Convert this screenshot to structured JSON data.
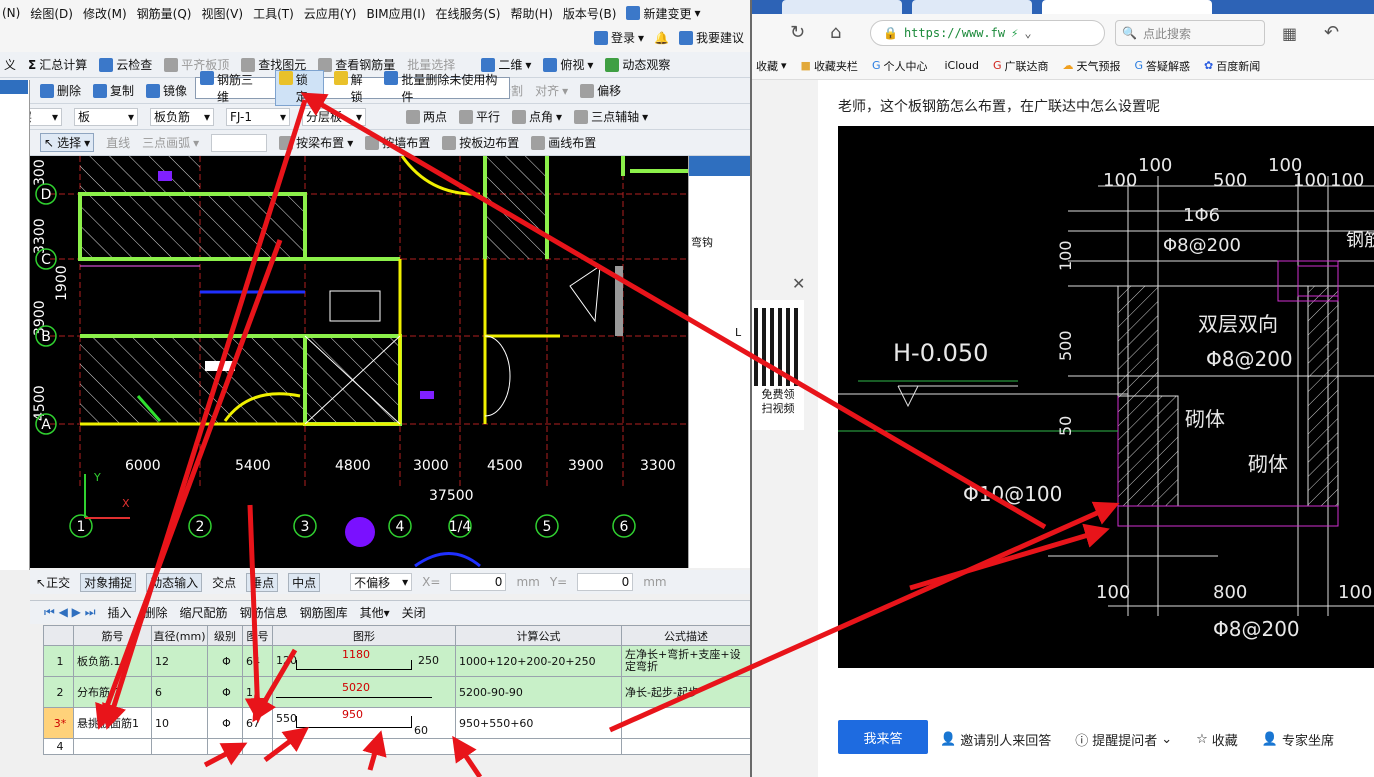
{
  "app": {
    "menus": [
      "(N)",
      "绘图(D)",
      "修改(M)",
      "钢筋量(Q)",
      "视图(V)",
      "工具(T)",
      "云应用(Y)",
      "BIM应用(I)",
      "在线服务(S)",
      "帮助(H)",
      "版本号(B)"
    ],
    "new_change": "新建变更",
    "login": "登录",
    "suggest": "我要建议",
    "toolbar1": [
      "义",
      "汇总计算",
      "云检查",
      "平齐板顶",
      "查找图元",
      "查看钢筋量",
      "批量选择",
      "二维",
      "俯视",
      "动态观察"
    ],
    "popup": {
      "steel3d": "钢筋三维",
      "lock": "锁定",
      "unlock": "解锁",
      "batch_delete": "批量删除未使用构件"
    },
    "toolbar2": {
      "delete": "删除",
      "copy": "复制",
      "mirror": "镜像",
      "split": "分割",
      "align": "对齐",
      "offset": "偏移"
    },
    "toolbar3": {
      "floor": "首层",
      "type": "板",
      "sub": "板负筋",
      "code": "FJ-1",
      "layer": "分层板",
      "two_point": "两点",
      "parallel": "平行",
      "point_angle": "点角",
      "three_point_axis": "三点辅轴"
    },
    "toolbar4": {
      "select": "选择",
      "line": "直线",
      "arc": "三点画弧",
      "by_beam": "按梁布置",
      "by_wall": "按墙布置",
      "by_edge": "按板边布置",
      "draw_line": "画线布置"
    },
    "cad": {
      "x_dims": [
        "6000",
        "5400",
        "4800",
        "3000",
        "4500",
        "3900",
        "3300"
      ],
      "total": "37500",
      "axes_x": [
        "1",
        "2",
        "3",
        "4",
        "1/4",
        "5",
        "6"
      ],
      "axes_y": [
        "D",
        "C",
        "B",
        "A"
      ],
      "y_dims": [
        "300",
        "3300",
        "1900",
        "3900",
        "4500"
      ],
      "axis_y_label": "Y",
      "axis_x_label": "X"
    },
    "right_panel": {
      "hook": "弯钩",
      "mark": "L"
    },
    "snapbar": {
      "ortho": "正交",
      "snap": "对象捕捉",
      "dynamic": "动态输入",
      "intersect": "交点",
      "perp": "垂点",
      "mid": "中点",
      "no_offset": "不偏移",
      "x_label": "X=",
      "x_val": "0",
      "mm1": "mm",
      "y_label": "Y=",
      "y_val": "0",
      "mm2": "mm"
    },
    "navbar": {
      "insert": "插入",
      "delete": "删除",
      "scale": "缩尺配筋",
      "info": "钢筋信息",
      "lib": "钢筋图库",
      "other": "其他",
      "close": "关闭"
    },
    "table": {
      "headers": [
        "",
        "筋号",
        "直径(mm)",
        "级别",
        "图号",
        "图形",
        "计算公式",
        "公式描述"
      ],
      "rows": [
        {
          "idx": "1",
          "name": "板负筋.1",
          "dia": "12",
          "grade": "Φ",
          "fig": "64",
          "l": "120",
          "m": "1180",
          "r": "250",
          "formula": "1000+120+200-20+250",
          "desc": "左净长+弯折+支座+设定弯折"
        },
        {
          "idx": "2",
          "name": "分布筋.1",
          "dia": "6",
          "grade": "Φ",
          "fig": "1",
          "l": "",
          "m": "5020",
          "r": "",
          "formula": "5200-90-90",
          "desc": "净长-起步-起步"
        },
        {
          "idx": "3*",
          "name": "悬挑板面筋1",
          "dia": "10",
          "grade": "Φ",
          "fig": "67",
          "l": "550",
          "m": "950",
          "r": "60",
          "formula": "950+550+60",
          "desc": ""
        },
        {
          "idx": "4",
          "name": "",
          "dia": "",
          "grade": "",
          "fig": "",
          "l": "",
          "m": "",
          "r": "",
          "formula": "",
          "desc": ""
        }
      ]
    }
  },
  "browser": {
    "url": "https://www.fw",
    "search_placeholder": "点此搜索",
    "bookmarks": [
      "收藏",
      "收藏夹栏",
      "个人中心",
      "iCloud",
      "广联达商",
      "天气预报",
      "答疑解惑",
      "百度新闻"
    ],
    "question": "老师，这个板钢筋怎么布置，在广联达中怎么设置呢",
    "qr_text1": "免费领",
    "qr_text2": "扫视频",
    "answer_btn": "我来答",
    "actions": [
      "邀请别人来回答",
      "提醒提问者",
      "收藏",
      "专家坐席"
    ],
    "dwg": {
      "top_dims": [
        "100",
        "100",
        "500",
        "100",
        "100",
        "100"
      ],
      "bar1": "1Φ6",
      "bar2": "Φ8@200",
      "steel": "钢筋",
      "level": "H-0.050",
      "left_dims": [
        "100",
        "500",
        "50"
      ],
      "double": "双层双向",
      "double_bar": "Φ8@200",
      "masonry1": "砌体",
      "masonry2": "砌体",
      "bottom_bar": "Φ10@100",
      "bot_dims": [
        "100",
        "800",
        "100"
      ],
      "bottom_rebar": "Φ8@200"
    }
  }
}
